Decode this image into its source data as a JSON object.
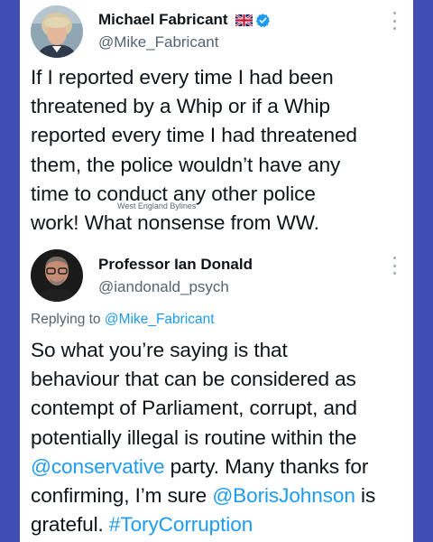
{
  "tweet1": {
    "display_name": "Michael Fabricant",
    "handle": "@Mike_Fabricant",
    "flag_icon": "uk-flag-icon",
    "verified_icon": "verified-badge-icon",
    "lines": [
      "If I reported every time I had been",
      "threatened by a Whip or if a Whip",
      "reported every time I had threatened",
      "them, the police wouldn’t have any",
      "time to conduct any other police",
      "work!  What nonsense from WW."
    ]
  },
  "watermark": "West England Bylines",
  "tweet2": {
    "display_name": "Professor Ian Donald",
    "handle": "@iandonald_psych",
    "replying_prefix": "Replying to",
    "replying_handle": "@Mike_Fabricant",
    "line1": "So what you’re saying is that",
    "line2": "behaviour that can be considered as",
    "line3": "contempt of Parliament, corrupt, and",
    "line4": "potentially illegal is routine within the",
    "line5_mention": "@conservative",
    "line5_rest": " party. Many thanks for",
    "line6_start": "confirming, I’m sure ",
    "line6_mention": "@BorisJohnson",
    "line6_end": " is",
    "line7_start": "grateful. ",
    "line7_hashtag": "#ToryCorruption"
  },
  "colors": {
    "background": "#3f4cb1",
    "link": "#1d9bf0",
    "text": "#0f1419",
    "muted": "#536471"
  }
}
